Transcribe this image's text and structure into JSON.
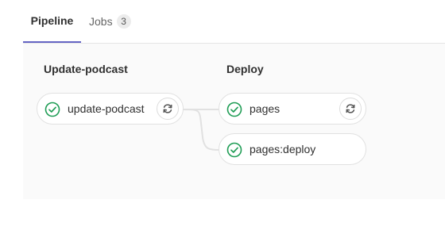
{
  "tabs": {
    "pipeline_label": "Pipeline",
    "jobs_label": "Jobs",
    "jobs_count": "3"
  },
  "stages": [
    {
      "title": "Update-podcast",
      "jobs": [
        {
          "name": "update-podcast",
          "status": "passed",
          "has_retry": true
        }
      ]
    },
    {
      "title": "Deploy",
      "jobs": [
        {
          "name": "pages",
          "status": "passed",
          "has_retry": true
        },
        {
          "name": "pages:deploy",
          "status": "passed",
          "has_retry": false
        }
      ]
    }
  ],
  "colors": {
    "success": "#1f9d55",
    "active_tab": "#6666c4",
    "connector": "#e1e1e1"
  },
  "icons": {
    "status": "check-circle-icon",
    "retry": "retry-icon"
  }
}
